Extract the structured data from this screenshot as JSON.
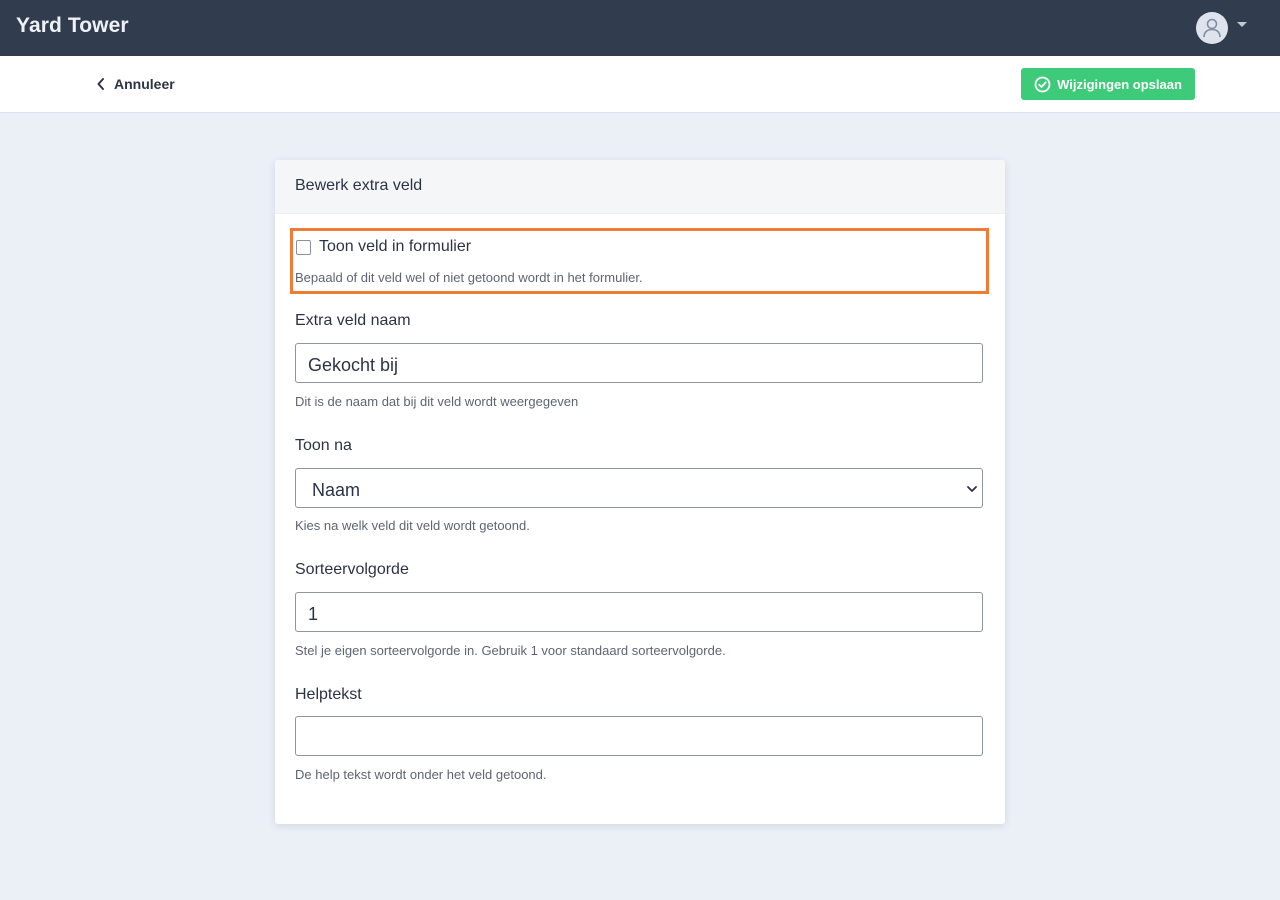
{
  "app": {
    "title": "Yard Tower"
  },
  "header": {
    "avatar_icon": "user-icon",
    "menu_icon": "caret-down-icon"
  },
  "actions": {
    "cancel_label": "Annuleer",
    "save_label": "Wijzigingen opslaan",
    "save_color": "#3ecb79"
  },
  "card": {
    "title": "Bewerk extra veld",
    "show_field": {
      "label": "Toon veld in formulier",
      "checked": false,
      "help": "Bepaald of dit veld wel of niet getoond wordt in het formulier.",
      "highlight_color": "#f07b34"
    },
    "name_field": {
      "label": "Extra veld naam",
      "value": "Gekocht bij",
      "help": "Dit is de naam dat bij dit veld wordt weergegeven"
    },
    "after_field": {
      "label": "Toon na",
      "selected": "Naam",
      "help": "Kies na welk veld dit veld wordt getoond."
    },
    "sort_field": {
      "label": "Sorteervolgorde",
      "value": "1",
      "help": "Stel je eigen sorteervolgorde in. Gebruik 1 voor standaard sorteervolgorde."
    },
    "helptext_field": {
      "label": "Helptekst",
      "value": "",
      "help": "De help tekst wordt onder het veld getoond."
    }
  }
}
